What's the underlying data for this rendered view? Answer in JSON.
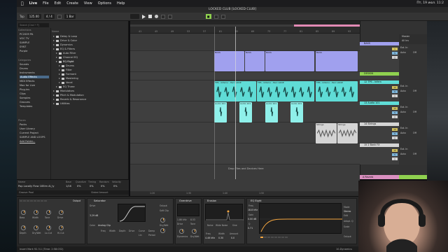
{
  "menubar": {
    "items": [
      "Live",
      "File",
      "Edit",
      "Create",
      "View",
      "Options",
      "Help"
    ],
    "clock": "Пт, 19 июл. 11:2"
  },
  "title": "LOCKED CLUB [LOCKED CLUB]",
  "transport": {
    "tap": "Tap",
    "tempo": "125.00",
    "time_sig": "4 / 4",
    "quant": "1 Bar"
  },
  "browser": {
    "search_placeholder": "Search (Cmd + F)",
    "collections_head": "Collections",
    "collections": [
      "PC2009 PA",
      "VOC TV",
      "SAMPLE",
      "SYNT",
      "Purple"
    ],
    "library_head": "Categories",
    "categories": [
      "Sounds",
      "Drums",
      "Instruments",
      "Audio Effects",
      "MIDI Effects",
      "Max for Live",
      "Plug-ins",
      "Clips",
      "Samples",
      "Grooves",
      "Templates"
    ],
    "places_head": "Places",
    "places": [
      "Packs",
      "User Library",
      "Current Project",
      "SAMPLE AND LOOPS",
      "Add Folder..."
    ],
    "names_head": "Name",
    "files": [
      {
        "name": "Delay & Loop",
        "level": 0
      },
      {
        "name": "Drive & Color",
        "level": 0
      },
      {
        "name": "Dynamics",
        "level": 0
      },
      {
        "name": "EQ & Filters",
        "level": 0
      },
      {
        "name": "Auto Filter",
        "level": 1
      },
      {
        "name": "Channel EQ",
        "level": 1
      },
      {
        "name": "EQ Eight",
        "level": 1
      },
      {
        "name": "Drums",
        "level": 2
      },
      {
        "name": "Filter",
        "level": 2
      },
      {
        "name": "Formant",
        "level": 2
      },
      {
        "name": "Mastering",
        "level": 2
      },
      {
        "name": "Vocal",
        "level": 2
      },
      {
        "name": "EQ Three",
        "level": 1
      },
      {
        "name": "Modulators",
        "level": 0
      },
      {
        "name": "Pitch & Modulation",
        "level": 0
      },
      {
        "name": "Reverb & Resonance",
        "level": 0
      },
      {
        "name": "Utilities",
        "level": 0
      }
    ],
    "selected_category": "Audio Effects",
    "selected_file": "EQ Eight"
  },
  "info": {
    "name_head": "Name",
    "file": "Pop Locally Flow 185lm Al_ly",
    "cols": [
      "Base",
      "Quantize",
      "Timing",
      "Random",
      "Velocity"
    ],
    "vals": [
      "1/16",
      "0%",
      "0%",
      "0%",
      "0%"
    ],
    "preview": "Groove Pool",
    "global_amount": "Global Amount"
  },
  "arrangement": {
    "ruler": [
      "41",
      "45",
      "49",
      "53",
      "57",
      "61",
      "65",
      "69",
      "73",
      "77",
      "81",
      "85",
      "89",
      "93"
    ],
    "times": [
      "1:20",
      "1:30",
      "1:40",
      "1:50"
    ],
    "drop_message": "Drop Files and Devices Here"
  },
  "clips": {
    "bass": "BASS",
    "perc": "TPS - Inferno - Perc LOOP",
    "audio": "Audio 101",
    "strings": "Strings"
  },
  "tracks": [
    {
      "name": "BASS",
      "color": "#a0a0ee",
      "send": "10 Dynamics - Va",
      "num": "1"
    },
    {
      "name": "DESIGN",
      "color": "#8fd14f",
      "send": "",
      "num": ""
    },
    {
      "name": "12 TPS - Infern",
      "color": "#5fdcd6",
      "send": "",
      "num": "12"
    },
    {
      "name": "13 Audio 101",
      "color": "#5fdcd6",
      "send": "",
      "num": "13"
    },
    {
      "name": "14 Strings",
      "color": "#d4d4d4",
      "send": "",
      "num": "14"
    },
    {
      "name": "15 2 Bank FX",
      "color": "#d4d4d4",
      "send": "",
      "num": "15"
    }
  ],
  "mixer": {
    "master": "Master",
    "all_ins": "All Ins",
    "auto": "Auto",
    "off": "Off",
    "ext_in": "Ext. In",
    "returns": "A Reverb",
    "in": "In"
  },
  "devices": {
    "saturator": {
      "title": "Saturator",
      "drive": "Drive",
      "drive_val": "3.29 dB",
      "mode": "Analog Clip",
      "output": "Output",
      "soft_clip": "Soft Clip",
      "dry_wet": "Dry/Wet",
      "freq": "Freq",
      "width": "Width",
      "depth": "Depth",
      "drive2": "Drive",
      "curve": "Curve",
      "lin": "Lin",
      "damp": "Damp",
      "period": "Period",
      "dryw": "Dry/Wet"
    },
    "overdrive": {
      "title": "Overdrive",
      "drive": "Drive",
      "tone": "Tone",
      "dynamics": "Dynamics",
      "drywet": "Dry/Wet",
      "drive_val": "1.86 kHz",
      "tone_val": "8.53"
    },
    "erosion": {
      "title": "Erosion",
      "mode": "Noise",
      "wide_noise": "Wide Noise",
      "sine": "Sine",
      "freq": "Freq",
      "width": "Width",
      "amount": "Amount",
      "freq_val": "4.46 kHz",
      "width_val": "0.30",
      "amount_val": "0.0"
    },
    "eq": {
      "title": "EQ Eight",
      "freq": "Freq",
      "gain": "Gain",
      "q": "Q",
      "freq_val": "18.8 kHz",
      "gain_val": "0.00 dB",
      "q_val": "0.71",
      "mode": "Mode",
      "stereo": "Stereo",
      "edit": "Edit",
      "adapt": "Adapt. Q",
      "scale": "Scale",
      "output": "Output"
    }
  },
  "macros": [
    "Bass",
    "Width",
    "Tone",
    "Drive",
    "Depth",
    "Dry/Wet",
    "Lo-Cut",
    "Hi-Cut"
  ],
  "status": {
    "left": "Insert Mark 92.3.1 (Time: 2:58:032)",
    "right": "10-Dynamics"
  },
  "colors": {
    "accent_orange": "#f4a640",
    "bass_clip": "#a0a0ee",
    "perc_clip": "#5fdcd6",
    "strings_clip": "#d4d4d4",
    "design_track": "#8fd14f",
    "return_track": "#d98fbf"
  }
}
